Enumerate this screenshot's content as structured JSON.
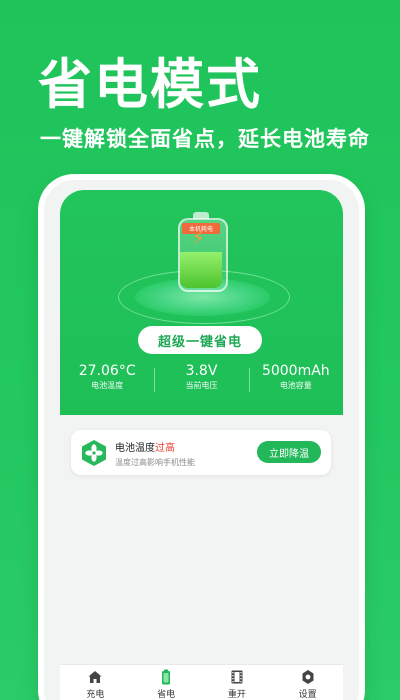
{
  "promo": {
    "title": "省电模式",
    "subtitle": "一键解锁全面省点，延长电池寿命"
  },
  "hero": {
    "battery_label": "本机耗电",
    "main_button": "超级一键省电",
    "stats": [
      {
        "value": "27.06°C",
        "label": "电池温度"
      },
      {
        "value": "3.8V",
        "label": "当前电压"
      },
      {
        "value": "5000mAh",
        "label": "电池容量"
      }
    ]
  },
  "alert": {
    "title_prefix": "电池温度",
    "title_highlight": "过高",
    "subtitle": "温度过高影响手机性能",
    "button": "立即降温"
  },
  "tabbar": {
    "items": [
      {
        "label": "充电",
        "icon": "home-icon"
      },
      {
        "label": "省电",
        "icon": "battery-icon"
      },
      {
        "label": "重开",
        "icon": "film-icon"
      },
      {
        "label": "设置",
        "icon": "gear-icon"
      }
    ],
    "active_index": 1
  },
  "colors": {
    "brand_green": "#22c45c",
    "alert_red": "#ec3b2c",
    "button_green": "#22b85a"
  }
}
